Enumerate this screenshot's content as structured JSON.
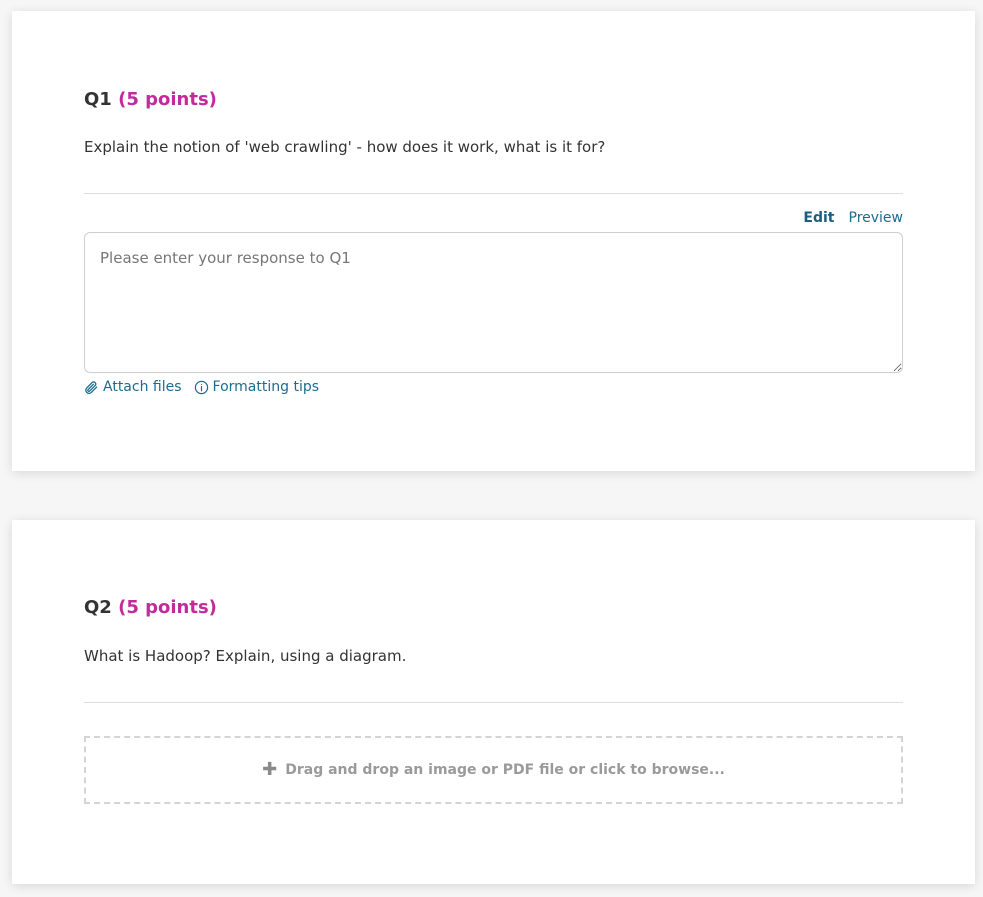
{
  "questions": [
    {
      "number": "Q1",
      "points": "(5 points)",
      "prompt": "Explain the notion of 'web crawling' - how does it work, what is it for?",
      "editor": {
        "tab_edit": "Edit",
        "tab_preview": "Preview",
        "placeholder": "Please enter your response to Q1",
        "value": ""
      },
      "tools": {
        "attach_label": "Attach files",
        "attach_icon": "paperclip-icon",
        "formatting_label": "Formatting tips",
        "formatting_icon": "info-circle-icon"
      }
    },
    {
      "number": "Q2",
      "points": "(5 points)",
      "prompt": "What is Hadoop? Explain, using a diagram.",
      "dropzone": {
        "icon": "plus-icon",
        "label": "Drag and drop an image or PDF file or click to browse..."
      }
    }
  ],
  "colors": {
    "points": "#c32b9b",
    "link": "#1b6c8e",
    "text": "#333333"
  }
}
